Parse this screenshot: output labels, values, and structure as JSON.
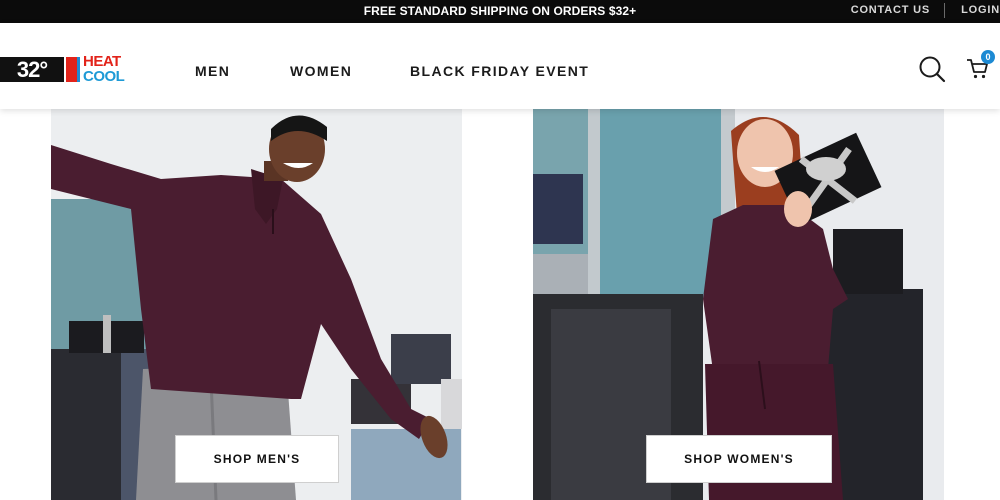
{
  "topbar": {
    "promo": "FREE STANDARD SHIPPING ON ORDERS $32+",
    "contact": "CONTACT US",
    "login": "LOGIN"
  },
  "logo": {
    "degree": "32°",
    "heat": "HEAT",
    "cool": "COOL"
  },
  "nav": {
    "items": [
      {
        "label": "MEN"
      },
      {
        "label": "WOMEN"
      },
      {
        "label": "BLACK FRIDAY EVENT"
      }
    ]
  },
  "cart": {
    "count": "0",
    "icon": "cart-icon"
  },
  "search": {
    "icon": "search-icon"
  },
  "hero": {
    "men_cta": "SHOP MEN'S",
    "women_cta": "SHOP WOMEN'S"
  },
  "colors": {
    "topbar_bg": "#0b0b0b",
    "brand_red": "#e2231a",
    "brand_blue": "#1e9ad6",
    "sweater": "#4a1d30",
    "pants_grey": "#8e8e92"
  }
}
